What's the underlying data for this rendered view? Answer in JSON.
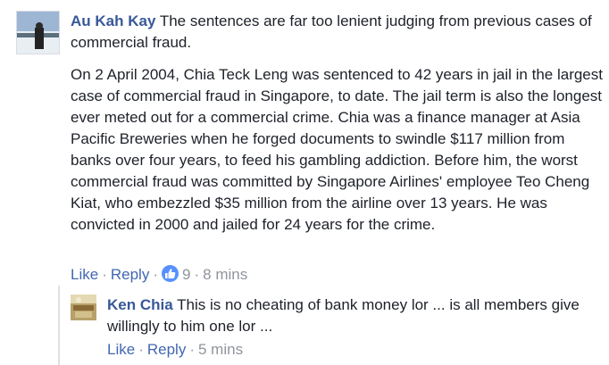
{
  "comment": {
    "author": "Au Kah Kay",
    "text_line": "The sentences are far too lenient judging from previous cases of commercial fraud.",
    "paragraph": "On 2 April 2004, Chia Teck Leng was sentenced to 42 years in jail in the largest case of commercial fraud in Singapore, to date. The jail term is also the longest ever meted out for a commercial crime. Chia was a finance manager at Asia Pacific Breweries when he forged documents to swindle $117 million from banks over four years, to feed his gambling addiction. Before him, the worst commercial fraud was committed by Singapore Airlines' employee Teo Cheng Kiat, who embezzled $35 million from the airline over 13 years. He was convicted in 2000 and jailed for 24 years for the crime.",
    "actions": {
      "like": "Like",
      "reply": "Reply",
      "reaction_count": "9",
      "time": "8 mins"
    },
    "reaction_icon": "thumbs-up-icon",
    "colors": {
      "author": "#385898",
      "link": "#4267b2",
      "meta": "#90949c",
      "like_badge": "#5890ff"
    }
  },
  "reply": {
    "author": "Ken Chia",
    "text": "This is no cheating of bank money lor ... is all members give willingly to him one lor ...",
    "actions": {
      "like": "Like",
      "reply": "Reply",
      "time": "5 mins"
    }
  }
}
